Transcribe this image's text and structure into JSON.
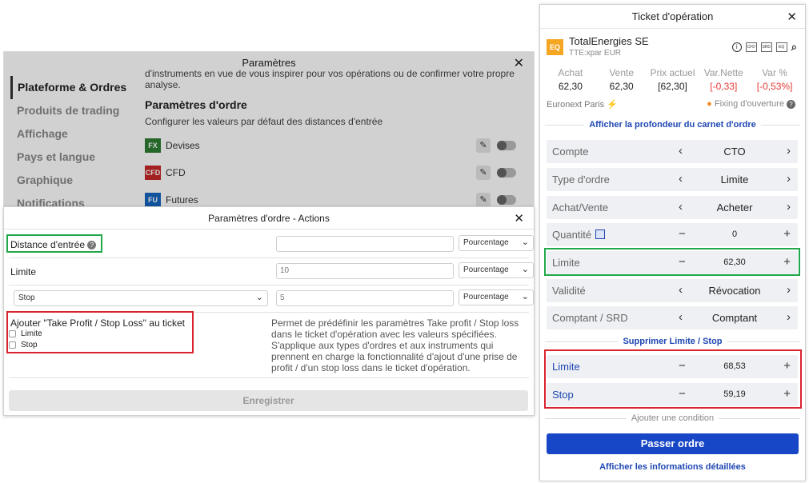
{
  "settings": {
    "title": "Paramètres",
    "close": "✕",
    "nav": [
      "Plateforme & Ordres",
      "Produits de trading",
      "Affichage",
      "Pays et langue",
      "Graphique",
      "Notifications"
    ],
    "intro": "d'instruments en vue de vous inspirer pour vos opérations ou de confirmer votre propre analyse.",
    "section_title": "Paramètres d'ordre",
    "section_sub": "Configurer les valeurs par défaut des distances d'entrée",
    "instruments": [
      {
        "badge": "FX",
        "label": "Devises",
        "color": "#2e7d32"
      },
      {
        "badge": "CFD",
        "label": "CFD",
        "color": "#c62828"
      },
      {
        "badge": "FU",
        "label": "Futures",
        "color": "#1565c0"
      }
    ]
  },
  "actions": {
    "title": "Paramètres d'ordre - Actions",
    "close": "✕",
    "distance_label": "Distance d'entrée",
    "help": "?",
    "distance_value": "",
    "distance_unit": "Pourcentage",
    "limit_label": "Limite",
    "limit_value": "10",
    "limit_unit": "Pourcentage",
    "stop_select": "Stop",
    "stop_value": "5",
    "stop_unit": "Pourcentage",
    "tp_label": "Ajouter \"Take Profit / Stop Loss\" au ticket",
    "tp_options": [
      "Limite",
      "Stop"
    ],
    "tp_description": "Permet de prédéfinir les paramètres Take profit / Stop loss dans le ticket d'opération avec les valeurs spécifiées. S'applique aux types d'ordres et aux instruments qui prennent en charge la fonctionnalité d'ajout d'une prise de profit / d'un stop loss dans le ticket d'opération.",
    "save": "Enregistrer",
    "chevron": "⌄"
  },
  "ticket": {
    "title": "Ticket d'opération",
    "close": "✕",
    "badge": "EQ",
    "name": "TotalEnergies SE",
    "sub": "TTE:xpar EUR",
    "icons": {
      "info": "i",
      "cfd": "CFD",
      "srd": "SRD",
      "eq": "EQ",
      "search": "⌕"
    },
    "quotes": [
      {
        "head": "Achat",
        "value": "62,30",
        "neg": false
      },
      {
        "head": "Vente",
        "value": "62,30",
        "neg": false
      },
      {
        "head": "Prix actuel",
        "value": "[62,30]",
        "neg": false
      },
      {
        "head": "Var.Nette",
        "value": "[-0,33]",
        "neg": true
      },
      {
        "head": "Var %",
        "value": "[-0,53%]",
        "neg": true
      }
    ],
    "market": "Euronext Paris",
    "bolt": "⚡",
    "fixing": "Fixing d'ouverture",
    "fixing_help": "?",
    "depth_link": "Afficher la profondeur du carnet d'ordre",
    "rows": [
      {
        "label": "Compte",
        "value": "CTO"
      },
      {
        "label": "Type d'ordre",
        "value": "Limite"
      },
      {
        "label": "Achat/Vente",
        "value": "Acheter"
      },
      {
        "label": "Quantité",
        "value": "0"
      },
      {
        "label": "Limite",
        "value": "62,30"
      },
      {
        "label": "Validité",
        "value": "Révocation"
      },
      {
        "label": "Comptant / SRD",
        "value": "Comptant"
      }
    ],
    "remove_link": "Supprimer Limite / Stop",
    "tp_rows": [
      {
        "label": "Limite",
        "value": "68,53"
      },
      {
        "label": "Stop",
        "value": "59,19"
      }
    ],
    "add_condition": "Ajouter une condition",
    "submit": "Passer ordre",
    "details_link": "Afficher les informations détaillées",
    "ctl": {
      "left": "‹",
      "right": "›",
      "minus": "−",
      "plus": "+"
    }
  }
}
